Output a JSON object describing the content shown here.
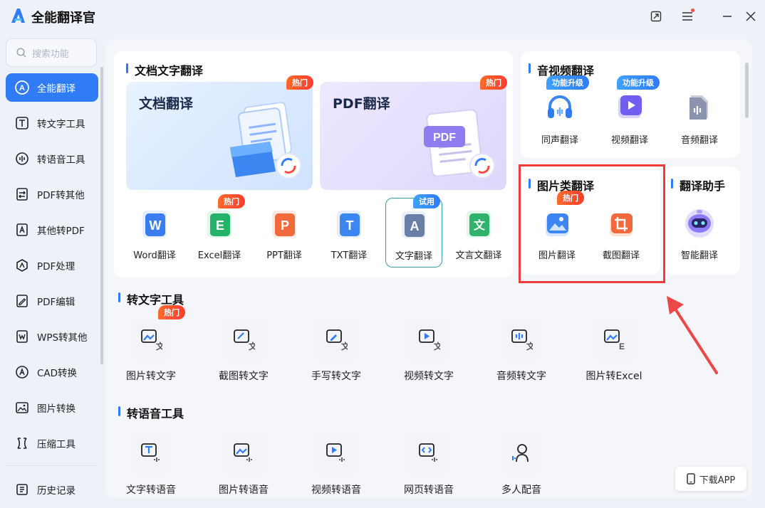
{
  "app": {
    "title": "全能翻译官"
  },
  "sidebar": {
    "search_placeholder": "搜索功能",
    "items": [
      {
        "label": "全能翻译",
        "icon": "translate-icon",
        "active": true
      },
      {
        "label": "转文字工具",
        "icon": "text-t-icon"
      },
      {
        "label": "转语音工具",
        "icon": "voice-icon"
      },
      {
        "label": "PDF转其他",
        "icon": "pdf-convert-icon"
      },
      {
        "label": "其他转PDF",
        "icon": "to-pdf-icon"
      },
      {
        "label": "PDF处理",
        "icon": "pdf-process-icon"
      },
      {
        "label": "PDF编辑",
        "icon": "pdf-edit-icon"
      },
      {
        "label": "WPS转其他",
        "icon": "wps-icon"
      },
      {
        "label": "CAD转换",
        "icon": "cad-icon"
      },
      {
        "label": "图片转换",
        "icon": "image-icon"
      },
      {
        "label": "压缩工具",
        "icon": "compress-icon"
      }
    ],
    "history": "历史记录"
  },
  "doc_translate": {
    "title": "文档文字翻译",
    "cards": [
      {
        "label": "文档翻译",
        "badge": "热门"
      },
      {
        "label": "PDF翻译",
        "badge": "热门",
        "art_text": "PDF"
      }
    ],
    "tiles": [
      {
        "label": "Word翻译",
        "letter": "W",
        "color": "#3b7cf0"
      },
      {
        "label": "Excel翻译",
        "letter": "E",
        "color": "#25b36a",
        "badge": "热门"
      },
      {
        "label": "PPT翻译",
        "letter": "P",
        "color": "#f26a3b"
      },
      {
        "label": "TXT翻译",
        "letter": "T",
        "color": "#3b86f0"
      },
      {
        "label": "文字翻译",
        "letter": "A",
        "color": "#6a7ea8",
        "badge": "试用"
      },
      {
        "label": "文言文翻译",
        "letter": "文",
        "color": "#2fb36a"
      }
    ]
  },
  "av_translate": {
    "title": "音视频翻译",
    "tiles": [
      {
        "label": "同声翻译",
        "badge": "功能升级"
      },
      {
        "label": "视频翻译",
        "badge": "功能升级"
      },
      {
        "label": "音频翻译"
      }
    ]
  },
  "image_translate": {
    "title": "图片类翻译",
    "tiles": [
      {
        "label": "图片翻译",
        "badge": "热门"
      },
      {
        "label": "截图翻译"
      }
    ]
  },
  "assistant": {
    "title": "翻译助手",
    "tiles": [
      {
        "label": "智能翻译"
      }
    ]
  },
  "to_text": {
    "title": "转文字工具",
    "tools": [
      {
        "label": "图片转文字",
        "badge": "热门"
      },
      {
        "label": "截图转文字"
      },
      {
        "label": "手写转文字"
      },
      {
        "label": "视频转文字"
      },
      {
        "label": "音频转文字"
      },
      {
        "label": "图片转Excel"
      }
    ]
  },
  "to_speech": {
    "title": "转语音工具",
    "tools": [
      {
        "label": "文字转语音"
      },
      {
        "label": "图片转语音"
      },
      {
        "label": "视频转语音"
      },
      {
        "label": "网页转语音"
      },
      {
        "label": "多人配音"
      }
    ]
  },
  "download": {
    "label": "下载APP"
  },
  "colors": {
    "accent": "#2f7cf6",
    "hot": "#ff4b2b",
    "highlight": "#ee3b3b"
  }
}
